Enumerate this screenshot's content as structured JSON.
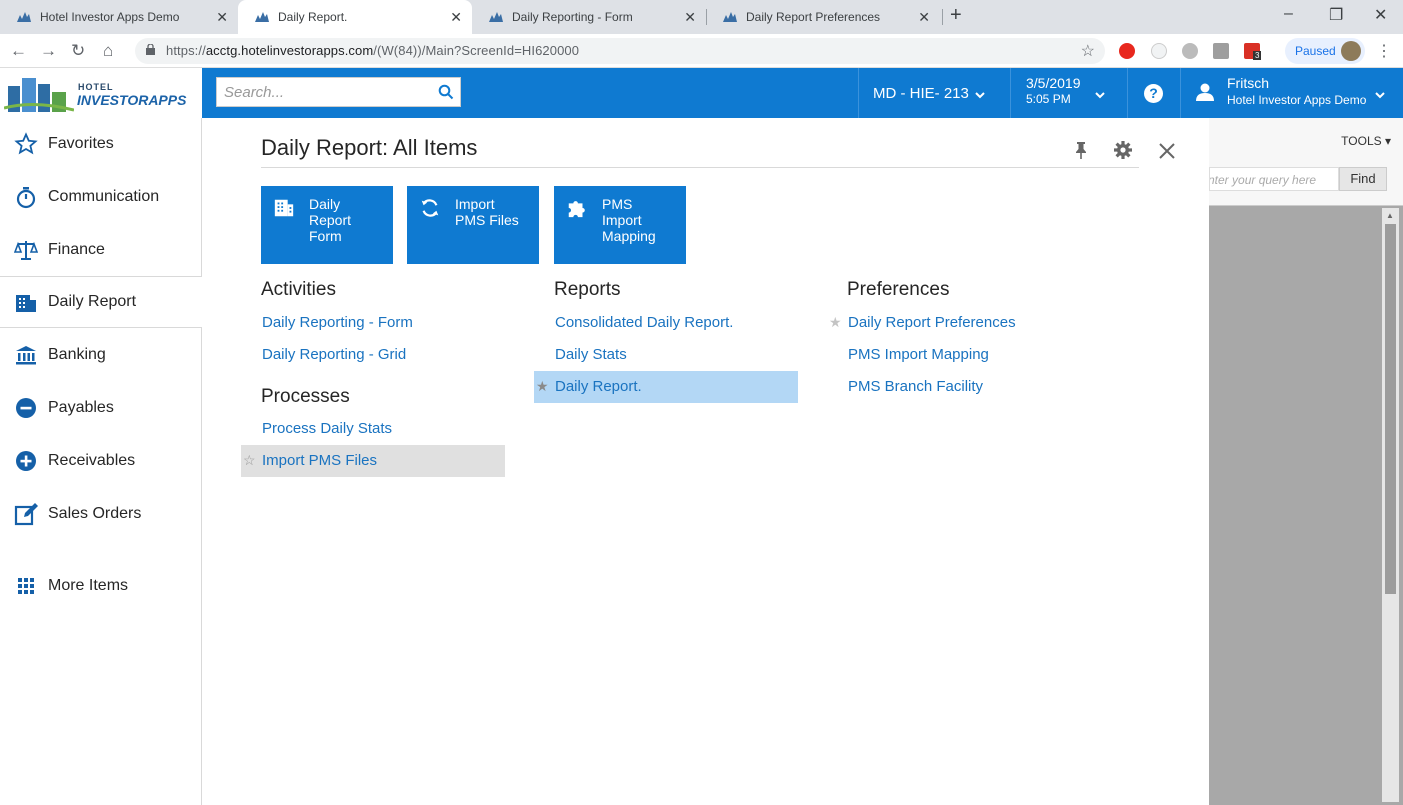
{
  "browser": {
    "tabs": [
      {
        "title": "Hotel Investor Apps Demo",
        "active": false
      },
      {
        "title": "Daily Report.",
        "active": true
      },
      {
        "title": "Daily Reporting - Form",
        "active": false
      },
      {
        "title": "Daily Report Preferences",
        "active": false
      }
    ],
    "url_base": "https://",
    "url_host": "acctg.hotelinvestorapps.com",
    "url_path": "/(W(84))/Main?ScreenId=HI620000",
    "profile_status": "Paused",
    "ext_badge": "3"
  },
  "header": {
    "logo_line1": "HOTEL",
    "logo_line2": "INVESTORAPPS",
    "search_placeholder": "Search...",
    "branch": "MD - HIE- 213",
    "date": "3/5/2019",
    "time": "5:05 PM",
    "user_name": "Fritsch",
    "company": "Hotel Investor Apps Demo"
  },
  "sidebar": {
    "items": [
      {
        "label": "Favorites",
        "icon": "star-icon"
      },
      {
        "label": "Communication",
        "icon": "stopwatch-icon"
      },
      {
        "label": "Finance",
        "icon": "scales-icon"
      },
      {
        "label": "Daily Report",
        "icon": "building-icon",
        "active": true
      },
      {
        "label": "Banking",
        "icon": "bank-icon"
      },
      {
        "label": "Payables",
        "icon": "minus-circle-icon"
      },
      {
        "label": "Receivables",
        "icon": "plus-circle-icon"
      },
      {
        "label": "Sales Orders",
        "icon": "edit-icon"
      },
      {
        "label": "More Items",
        "icon": "grid-icon"
      }
    ]
  },
  "panel": {
    "title": "Daily Report: All Items",
    "tiles": [
      {
        "label_lines": [
          "Daily",
          "Report",
          "Form"
        ],
        "icon": "building-icon"
      },
      {
        "label_lines": [
          "Import",
          "PMS Files"
        ],
        "icon": "sync-icon"
      },
      {
        "label_lines": [
          "PMS",
          "Import",
          "Mapping"
        ],
        "icon": "puzzle-icon"
      }
    ],
    "activities": {
      "heading": "Activities",
      "links": [
        "Daily Reporting - Form",
        "Daily Reporting - Grid"
      ]
    },
    "processes": {
      "heading": "Processes",
      "links": [
        "Process Daily Stats",
        "Import PMS Files"
      ]
    },
    "reports": {
      "heading": "Reports",
      "links": [
        "Consolidated Daily Report.",
        "Daily Stats",
        "Daily Report."
      ]
    },
    "preferences": {
      "heading": "Preferences",
      "links": [
        "Daily Report Preferences",
        "PMS Import Mapping",
        "PMS Branch Facility"
      ]
    }
  },
  "backdrop": {
    "tools_label": "TOOLS",
    "query_placeholder": "Enter your query here",
    "find_label": "Find"
  },
  "colors": {
    "brand_blue": "#0f7ad1",
    "link_blue": "#1a73c0",
    "highlight_blue": "#b3d7f5"
  }
}
